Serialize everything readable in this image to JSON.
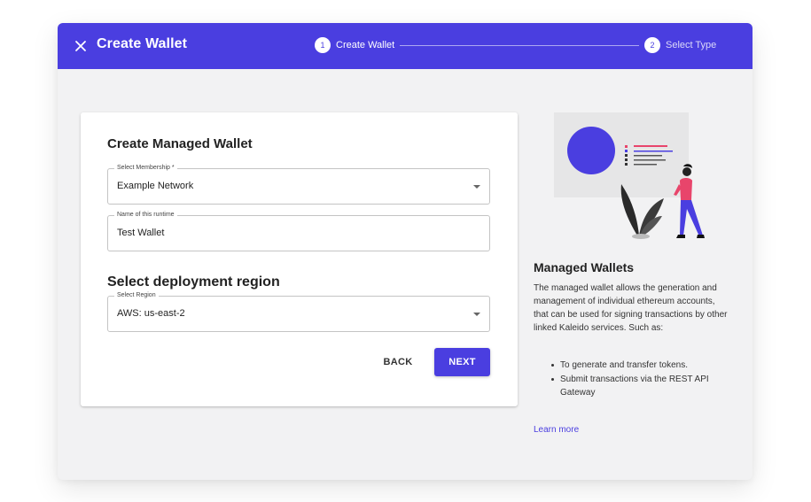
{
  "appbar": {
    "title": "Create Wallet",
    "close_icon": "close-icon",
    "steps": [
      {
        "number": "1",
        "label": "Create Wallet",
        "active": true
      },
      {
        "number": "2",
        "label": "Select Type",
        "active": false
      }
    ]
  },
  "form": {
    "heading": "Create Managed Wallet",
    "membership": {
      "label": "Select Membership *",
      "value": "Example Network"
    },
    "runtime_name": {
      "label": "Name of this runtime",
      "value": "Test Wallet"
    },
    "region_heading": "Select deployment region",
    "region": {
      "label": "Select Region",
      "value": "AWS: us-east-2"
    },
    "back_label": "BACK",
    "next_label": "NEXT"
  },
  "sidebar": {
    "title": "Managed Wallets",
    "description": "The managed wallet allows the generation and management of individual ethereum accounts, that can be used for signing transactions by other linked Kaleido services. Such as:",
    "items": [
      "To generate and transfer tokens.",
      "Submit transactions via the REST API Gateway"
    ],
    "learn_more": "Learn more"
  },
  "colors": {
    "accent": "#4a3ee0",
    "figure_top": "#e8456b",
    "figure_pants": "#4a3ee0"
  }
}
